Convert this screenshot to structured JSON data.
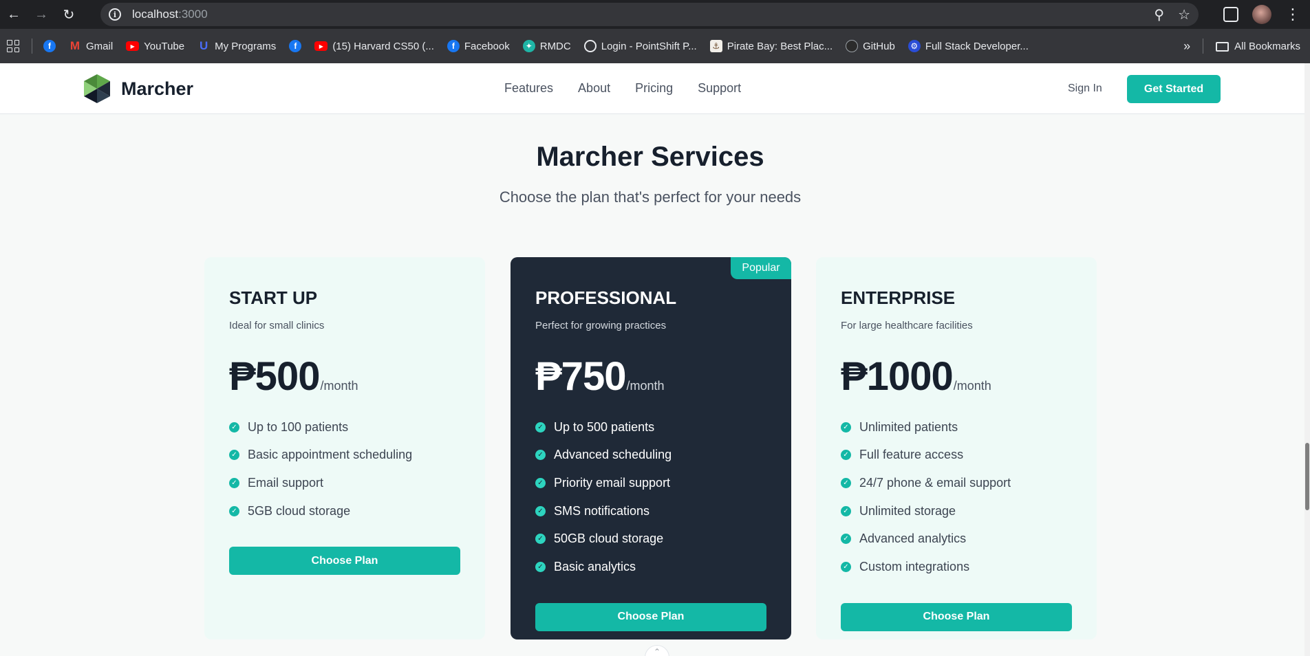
{
  "browser": {
    "url_host": "localhost",
    "url_port": ":3000",
    "bookmarks": [
      {
        "label": "",
        "icon": "facebook-icon"
      },
      {
        "label": "Gmail",
        "icon": "gmail-icon"
      },
      {
        "label": "YouTube",
        "icon": "youtube-icon"
      },
      {
        "label": "My Programs",
        "icon": "my-programs-icon"
      },
      {
        "label": "",
        "icon": "facebook-icon"
      },
      {
        "label": "(15) Harvard CS50 (...",
        "icon": "youtube-icon"
      },
      {
        "label": "Facebook",
        "icon": "facebook-icon"
      },
      {
        "label": "RMDC",
        "icon": "rmdc-icon"
      },
      {
        "label": "Login - PointShift P...",
        "icon": "globe-icon"
      },
      {
        "label": "Pirate Bay: Best Plac...",
        "icon": "pirate-bay-icon"
      },
      {
        "label": "GitHub",
        "icon": "github-icon"
      },
      {
        "label": "Full Stack Developer...",
        "icon": "full-stack-icon"
      }
    ],
    "all_bookmarks_label": "All Bookmarks"
  },
  "site": {
    "brand": "Marcher",
    "nav": [
      "Features",
      "About",
      "Pricing",
      "Support"
    ],
    "sign_in": "Sign In",
    "get_started": "Get Started"
  },
  "pricing": {
    "title": "Marcher Services",
    "subtitle": "Choose the plan that's perfect for your needs",
    "popular_badge": "Popular",
    "plans": [
      {
        "name": "START UP",
        "description": "Ideal for small clinics",
        "price": "₱500",
        "period": "/month",
        "features": [
          "Up to 100 patients",
          "Basic appointment scheduling",
          "Email support",
          "5GB cloud storage"
        ],
        "button": "Choose Plan"
      },
      {
        "name": "PROFESSIONAL",
        "description": "Perfect for growing practices",
        "price": "₱750",
        "period": "/month",
        "features": [
          "Up to 500 patients",
          "Advanced scheduling",
          "Priority email support",
          "SMS notifications",
          "50GB cloud storage",
          "Basic analytics"
        ],
        "button": "Choose Plan"
      },
      {
        "name": "ENTERPRISE",
        "description": "For large healthcare facilities",
        "price": "₱1000",
        "period": "/month",
        "features": [
          "Unlimited patients",
          "Full feature access",
          "24/7 phone & email support",
          "Unlimited storage",
          "Advanced analytics",
          "Custom integrations"
        ],
        "button": "Choose Plan"
      }
    ]
  },
  "colors": {
    "accent": "#14b8a6",
    "dark_card": "#1f2937",
    "light_card": "#eefaf7",
    "text_dark": "#17202d"
  }
}
